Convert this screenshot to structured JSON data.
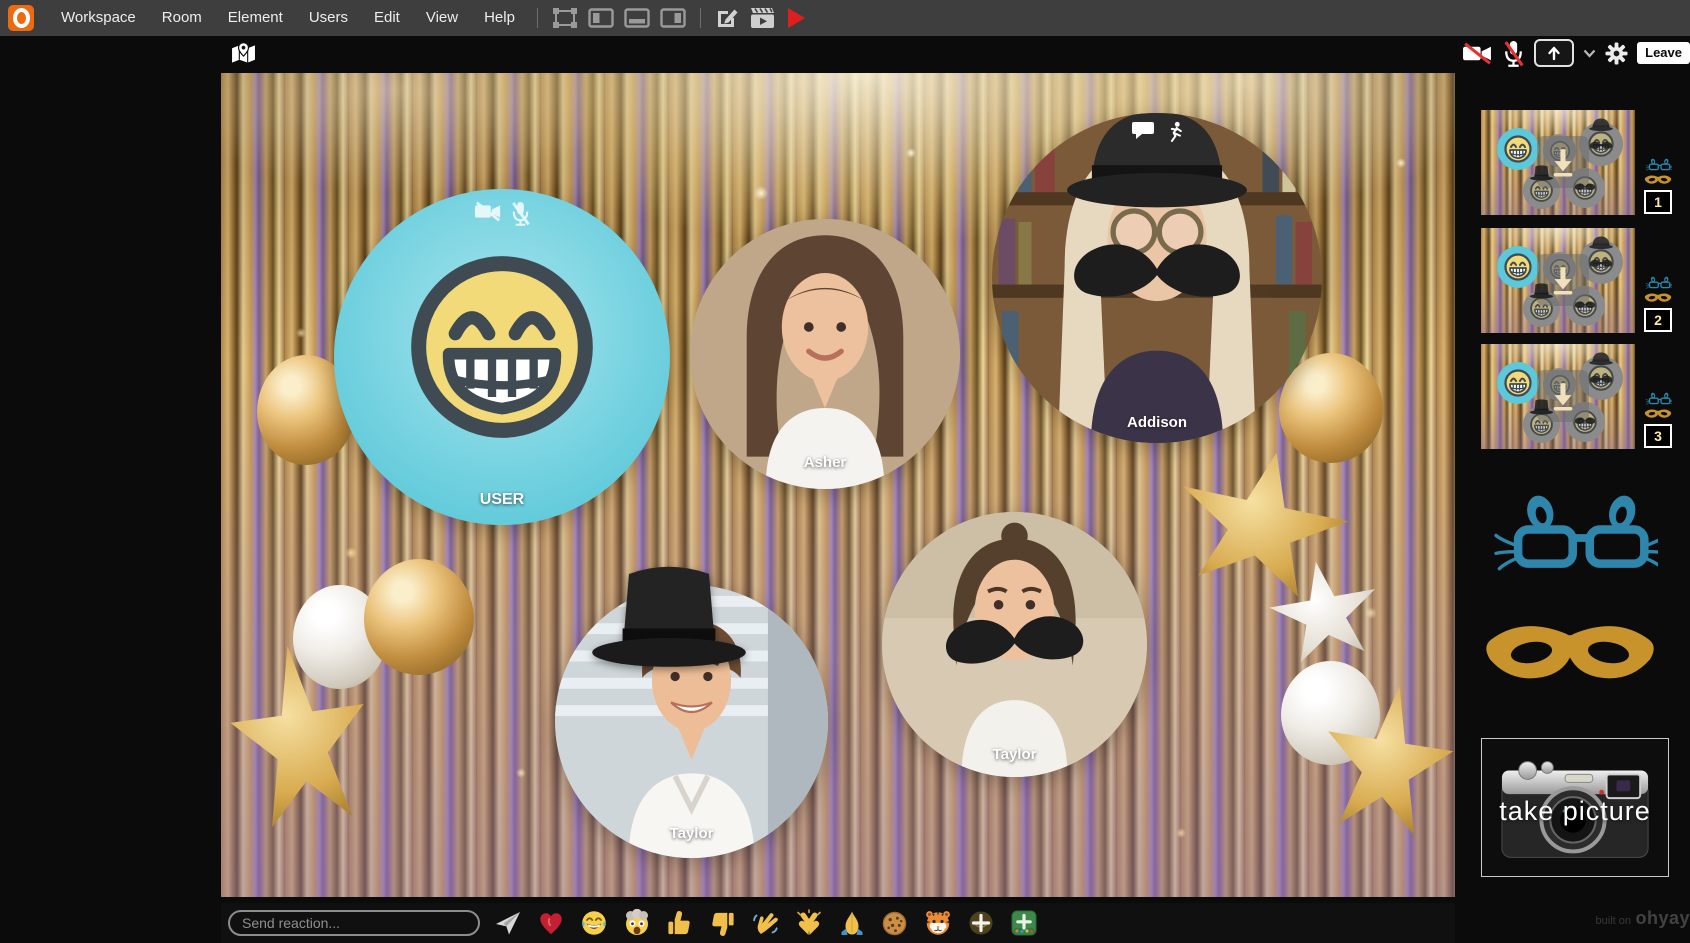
{
  "menu_bar": {
    "items": [
      "Workspace",
      "Room",
      "Element",
      "Users",
      "Edit",
      "View",
      "Help"
    ],
    "tool_icons": [
      "transform-icon",
      "panel-left-icon",
      "panel-bottom-icon",
      "panel-right-icon",
      "compose-icon",
      "scenes-icon",
      "record-icon"
    ]
  },
  "top_bar": {
    "icons": [
      "map-icon",
      "camera-off-icon",
      "mic-off-icon",
      "share-screen-icon",
      "chevron-down-icon",
      "settings-gear-icon"
    ],
    "leave_label": "Leave"
  },
  "stage": {
    "participants": [
      {
        "name": "USER",
        "type": "emoji-avatar",
        "status_icons": [
          "camera-off",
          "mic-off"
        ]
      },
      {
        "name": "Asher",
        "type": "video"
      },
      {
        "name": "Addison",
        "type": "video",
        "accessories": [
          "bowler-hat",
          "round-glasses",
          "mustache",
          "wig"
        ],
        "status_icons": [
          "chat-bubble",
          "runner"
        ]
      },
      {
        "name": "Taylor",
        "type": "video",
        "accessories": [
          "top-hat"
        ]
      },
      {
        "name": "Taylor",
        "type": "video",
        "accessories": [
          "mustache"
        ]
      }
    ]
  },
  "sidebar": {
    "snapshots": [
      {
        "label": "1"
      },
      {
        "label": "2"
      },
      {
        "label": "3"
      }
    ],
    "props": [
      "bunny-glasses",
      "masquerade-mask"
    ],
    "take_picture_label": "take picture"
  },
  "reaction_bar": {
    "input_placeholder": "Send reaction...",
    "reactions": [
      "send-reaction",
      "heart",
      "laughing",
      "exploding-head",
      "thumbs-up",
      "thumbs-down",
      "waving-hand",
      "clapping-hands",
      "folded-hands",
      "cookie",
      "tiger-face",
      "add-reaction",
      "add-emoji"
    ]
  },
  "footer": {
    "built_on": "built on",
    "brand": "ohyay"
  },
  "colors": {
    "accent_orange": "#ec6a10",
    "user_circle_cyan": "#63cbdb",
    "record_red": "#df1f1f",
    "add_emoji_green": "#3c8a48",
    "prop_blue": "#2e86ad",
    "prop_gold": "#c9932b"
  }
}
